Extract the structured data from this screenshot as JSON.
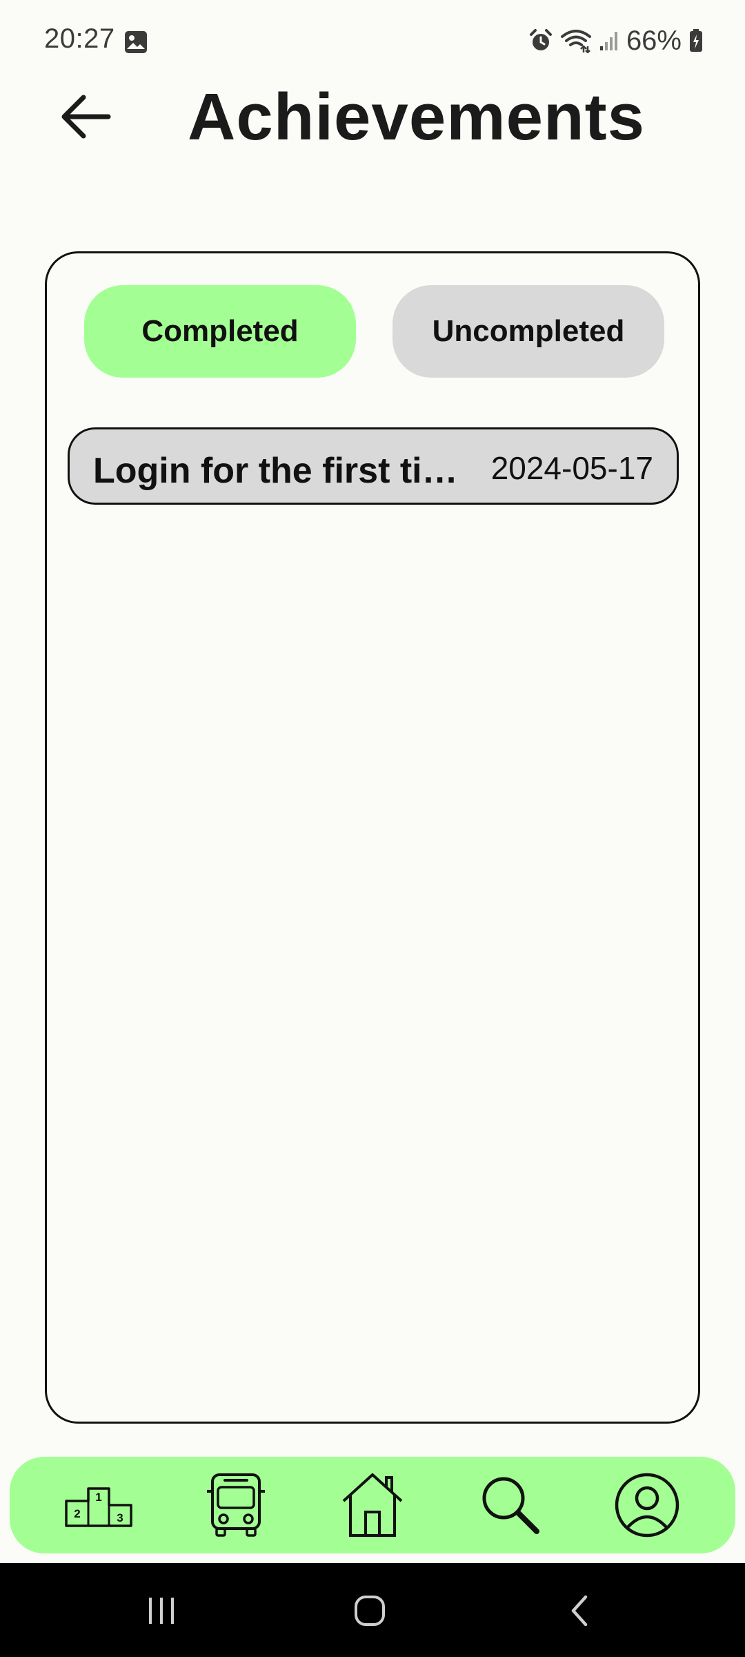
{
  "status_bar": {
    "time": "20:27",
    "battery": "66%",
    "icons": [
      "image-icon",
      "alarm-icon",
      "wifi-icon",
      "signal-icon",
      "battery-icon"
    ]
  },
  "header": {
    "title": "Achievements",
    "back_icon": "arrow-left-icon"
  },
  "tabs": [
    {
      "label": "Completed",
      "active": true
    },
    {
      "label": "Uncompleted",
      "active": false
    }
  ],
  "achievements": [
    {
      "title": "Login for the first time",
      "date": "2024-05-17"
    }
  ],
  "bottom_nav": {
    "items": [
      "leaderboard-podium-icon",
      "bus-icon",
      "home-icon",
      "search-icon",
      "profile-icon"
    ],
    "podium_numbers": [
      "1",
      "2",
      "3"
    ]
  },
  "system_nav": [
    "recent-apps-icon",
    "home-circle-icon",
    "back-chevron-icon"
  ],
  "colors": {
    "background": "#fbfcf7",
    "accent_green": "#a3ff93",
    "inactive_gray": "#d9d9d9",
    "text": "#1b1b1b"
  }
}
